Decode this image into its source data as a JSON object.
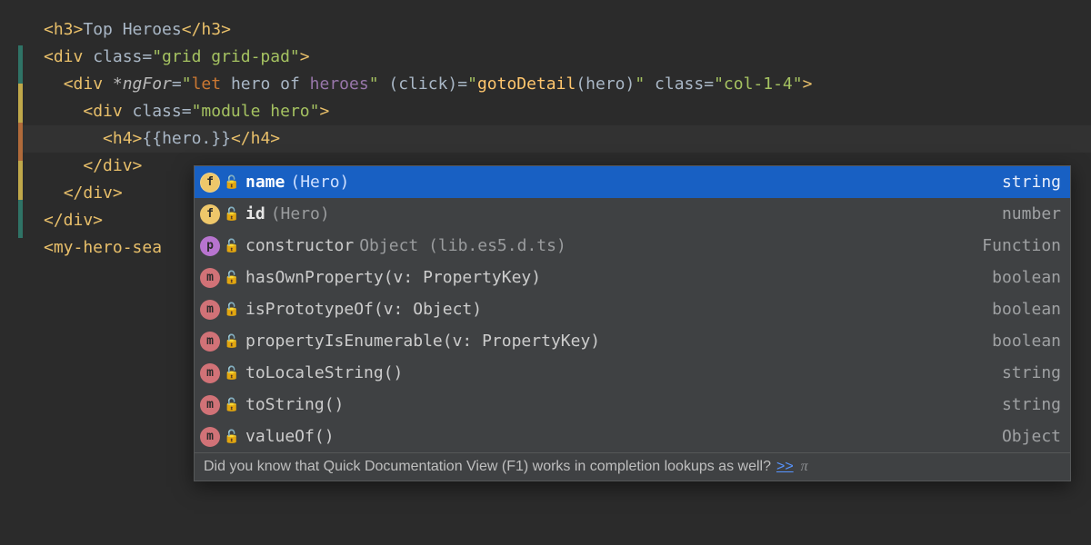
{
  "code": {
    "l1": {
      "open": "<h3>",
      "text": "Top Heroes",
      "close": "</h3>"
    },
    "l2": {
      "open": "<div ",
      "attr": "class",
      "eq": "=",
      "val": "\"grid grid-pad\"",
      "end": ">"
    },
    "l3": {
      "open": "<div ",
      "dir": "*ngFor",
      "eq1": "=",
      "q1": "\"",
      "kw": "let",
      "sp1": " ",
      "hero": "hero",
      "of": " of ",
      "heroes": "heroes",
      "q2": "\"",
      "clickAttr": " (click)",
      "eq2": "=",
      "q3": "\"",
      "fn": "gotoDetail",
      "paren": "(hero)",
      "q4": "\"",
      "classAttr": " class",
      "eq3": "=",
      "classVal": "\"col-1-4\"",
      "end": ">"
    },
    "l4": {
      "open": "<div ",
      "attr": "class",
      "eq": "=",
      "val": "\"module hero\"",
      "end": ">"
    },
    "l5": {
      "open": "<h4>",
      "interpOpen": "{{",
      "expr": "hero.",
      "interpClose": "}}",
      "close": "</h4>"
    },
    "l6": "</div>",
    "l7": "</div>",
    "l8": "</div>",
    "l9": "<my-hero-sea"
  },
  "completions": [
    {
      "kind": "f",
      "name": "name",
      "meta": "(Hero)",
      "type": "string",
      "selected": true
    },
    {
      "kind": "f",
      "name": "id",
      "meta": "(Hero)",
      "type": "number"
    },
    {
      "kind": "p",
      "name": "constructor",
      "meta": "Object (lib.es5.d.ts)",
      "type": "Function"
    },
    {
      "kind": "m",
      "name": "hasOwnProperty(v: PropertyKey)",
      "meta": "",
      "type": "boolean"
    },
    {
      "kind": "m",
      "name": "isPrototypeOf(v: Object)",
      "meta": "",
      "type": "boolean"
    },
    {
      "kind": "m",
      "name": "propertyIsEnumerable(v: PropertyKey)",
      "meta": "",
      "type": "boolean"
    },
    {
      "kind": "m",
      "name": "toLocaleString()",
      "meta": "",
      "type": "string"
    },
    {
      "kind": "m",
      "name": "toString()",
      "meta": "",
      "type": "string"
    },
    {
      "kind": "m",
      "name": "valueOf()",
      "meta": "",
      "type": "Object"
    }
  ],
  "hint": {
    "text": "Did you know that Quick Documentation View (F1) works in completion lookups as well?",
    "link": ">>",
    "pi": "π"
  }
}
